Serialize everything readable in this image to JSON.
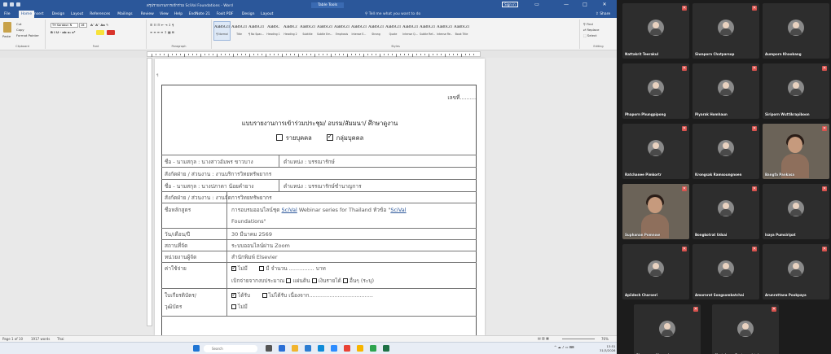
{
  "word": {
    "title": "สรุปรายงานการเข้าร่วม SciVal Foundations - Word",
    "title_segment": "Table Tools",
    "signin_label": "Sign in",
    "tabs": [
      "File",
      "Home",
      "Insert",
      "Design",
      "Layout",
      "References",
      "Mailings",
      "Review",
      "View",
      "Help",
      "EndNote 21",
      "Foxit PDF",
      "Design",
      "Layout"
    ],
    "active_tab": "Home",
    "tell_me": "Tell me what you want to do",
    "share_label": "Share",
    "ribbon": {
      "paste_label": "Paste",
      "cut_label": "Cut",
      "copy_label": "Copy",
      "format_painter_label": "Format Painter",
      "clipboard_group": "Clipboard",
      "font_name": "TH Sarabun N",
      "font_size": "16",
      "font_group": "Font",
      "paragraph_group": "Paragraph",
      "styles_group": "Styles",
      "editing_group": "Editing",
      "find_label": "Find",
      "replace_label": "Replace",
      "select_label": "Select",
      "styles": [
        {
          "sample": "AaBbCcI",
          "name": "¶ Normal"
        },
        {
          "sample": "AaBbCcI",
          "name": "Title"
        },
        {
          "sample": "AaBbCcI",
          "name": "¶ No Spac..."
        },
        {
          "sample": "AaBbC",
          "name": "Heading 1"
        },
        {
          "sample": "AaBbCc",
          "name": "Heading 2"
        },
        {
          "sample": "AaBbCcI",
          "name": "Subtitle"
        },
        {
          "sample": "AaBbCcI",
          "name": "Subtle Em..."
        },
        {
          "sample": "AaBbCcI",
          "name": "Emphasis"
        },
        {
          "sample": "AaBbCcI",
          "name": "Intense E..."
        },
        {
          "sample": "AaBbCcI",
          "name": "Strong"
        },
        {
          "sample": "AaBbCcI",
          "name": "Quote"
        },
        {
          "sample": "AaBbCcI",
          "name": "Intense Q..."
        },
        {
          "sample": "AaBbCcI",
          "name": "Subtle Ref..."
        },
        {
          "sample": "AaBbCcI",
          "name": "Intense Re..."
        },
        {
          "sample": "AaBbCcI",
          "name": "Book Title"
        }
      ]
    },
    "status": {
      "page": "Page 1 of 10",
      "words": "1917 words",
      "language": "Thai",
      "zoom": "76%"
    }
  },
  "doc": {
    "number_label": "เลขที่..........",
    "title": "แบบรายงานการเข้าร่วมประชุม/ อบรม/สัมมนา/ ศึกษาดูงาน",
    "opt_individual": "รายบุคคล",
    "opt_group": "กลุ่มบุคคล",
    "name1": "ชื่อ - นามสกุล  :  นางสาวอัมพร ขาวบาง",
    "pos1": "ตำแหน่ง : บรรณารักษ์",
    "dept1": "สังกัดฝ่าย / ส่วนงาน  :  งานบริการวิทยทรัพยากร",
    "name2": "ชื่อ - นามสกุล  :  นางปภาดา น้อยคำยาง",
    "pos2": "ตำแหน่ง : บรรณารักษ์ชำนาญการ",
    "dept2": "สังกัดฝ่าย / ส่วนงาน  :  งานจัดการวิทยทรัพยากร",
    "course_label": "ชื่อหลักสูตร",
    "course_value_prefix": "การอบรมออนไลน์ชุด",
    "course_link1": "SciVal",
    "course_value_mid": "Webinar series for Thailand หัวข้อ \"",
    "course_link2": "SciVal",
    "course_value_end": "Foundations\"",
    "date_label": "วัน/เดือน/ปี",
    "date_value": "30 มีนาคม 2569",
    "place_label": "สถานที่จัด",
    "place_value": "ระบบออนไลน์ผ่าน Zoom",
    "org_label": "หน่วยงานผู้จัด",
    "org_value": "สำนักพิมพ์ Elsevier",
    "cost_label": "ค่าใช้จ่าย",
    "cost_none": "ไม่มี",
    "cost_has": "มี จำนวน ............... บาท",
    "cost_source_prefix": "เบิกจ่ายจากงบประมาณ",
    "cost_src1": "แผ่นดิน",
    "cost_src2": "เงินรายได้",
    "cost_src3": "อื่นๆ (ระบุ)",
    "cert_label1": "ใบเกียรติบัตร/",
    "cert_label2": "วุฒิบัตร",
    "cert_got": "ได้รับ",
    "cert_not_got": "ไม่ได้รับ เนื่องจาก......................................",
    "cert_none": "ไม่มี"
  },
  "taskbar": {
    "search_placeholder": "Search",
    "time": "13:51",
    "date": "31/3/2026"
  },
  "gallery": {
    "participants": [
      {
        "name": "Nattakrit Teerakul",
        "muted": true,
        "video": false
      },
      {
        "name": "Siwaporn Chatparsop",
        "muted": true,
        "video": false
      },
      {
        "name": "Aumporn Khaobang",
        "muted": false,
        "video": false
      },
      {
        "name": "Phaporn Phungpipong",
        "muted": true,
        "video": false
      },
      {
        "name": "Piyarak Homhaun",
        "muted": true,
        "video": false
      },
      {
        "name": "Siriporn Wuttikrapiboon",
        "muted": true,
        "video": false
      },
      {
        "name": "Ratchanee Pimkortr",
        "muted": true,
        "video": false
      },
      {
        "name": "Krongsak Ramsoungnoen",
        "muted": true,
        "video": false
      },
      {
        "name": "Bangfa Pankasa",
        "muted": true,
        "video": true
      },
      {
        "name": "Suphanan Pomnow",
        "muted": true,
        "video": true
      },
      {
        "name": "Bongkotrat Udsai",
        "muted": true,
        "video": false
      },
      {
        "name": "Isaya Pumsiripat",
        "muted": true,
        "video": false
      },
      {
        "name": "Apiidech Charoeri",
        "muted": true,
        "video": false
      },
      {
        "name": "Amornrat Songsombatchai",
        "muted": true,
        "video": false
      },
      {
        "name": "Arunrattana Pookpaya",
        "muted": true,
        "video": false
      },
      {
        "name": "Pimonpan Moonchareon",
        "muted": true,
        "video": false
      },
      {
        "name": "Chatchapa Pratumwhtajorn",
        "muted": true,
        "video": false
      }
    ]
  }
}
